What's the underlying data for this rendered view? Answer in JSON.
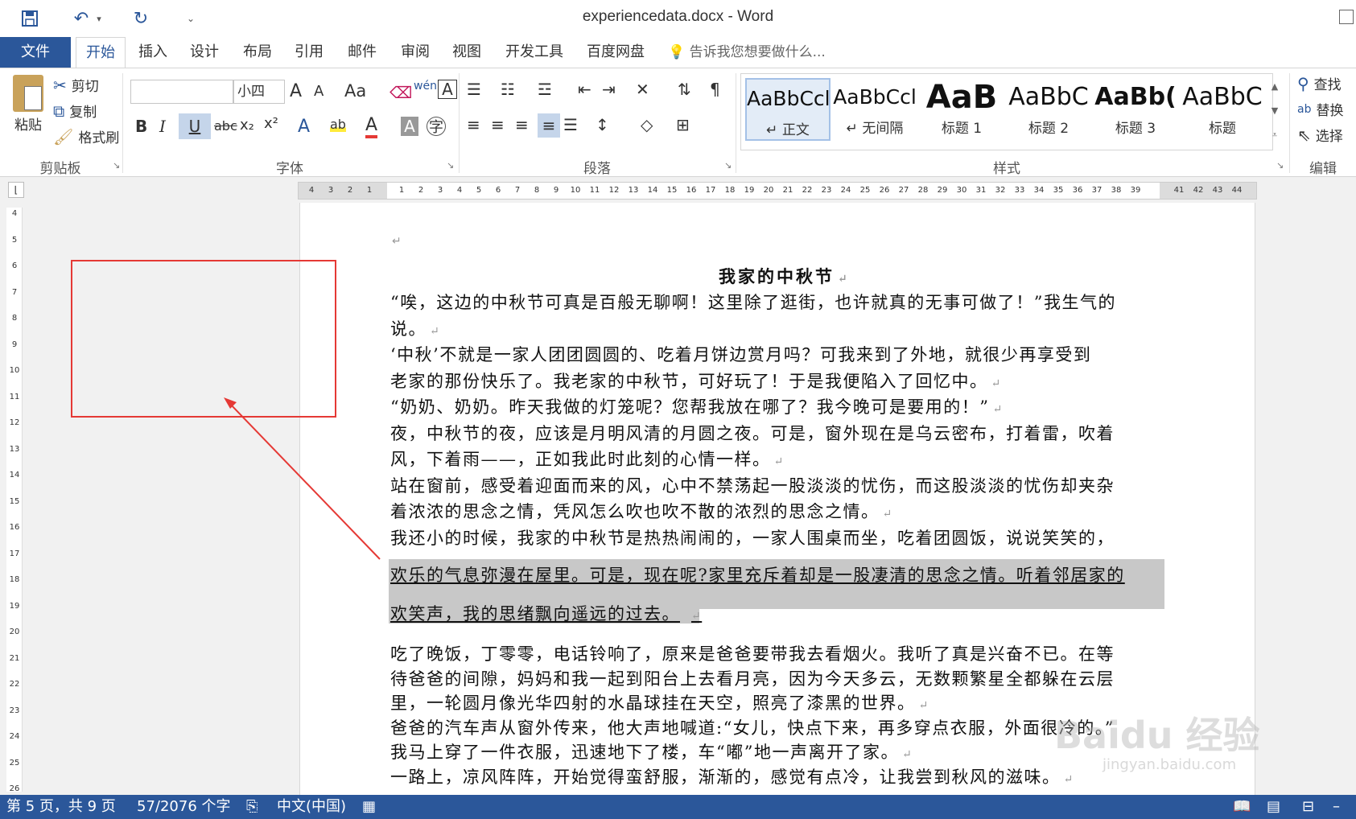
{
  "window": {
    "title": "experiencedata.docx - Word"
  },
  "ribbon_tabs": [
    "文件",
    "开始",
    "插入",
    "设计",
    "布局",
    "引用",
    "邮件",
    "审阅",
    "视图",
    "开发工具",
    "百度网盘"
  ],
  "tellme": "告诉我您想要做什么...",
  "clipboard": {
    "paste": "粘贴",
    "cut": "剪切",
    "copy": "复制",
    "format_painter": "格式刷",
    "label": "剪贴板"
  },
  "font": {
    "name": "",
    "size": "小四",
    "label": "字体",
    "bold": "B",
    "italic": "I",
    "underline": "U",
    "strike": "abc",
    "sub": "x₂",
    "sup": "x²",
    "change_case": "Aa",
    "grow": "A",
    "shrink": "A"
  },
  "paragraph": {
    "label": "段落"
  },
  "styles": {
    "label": "样式",
    "items": [
      {
        "sample": "AaBbCcl",
        "name": "↵ 正文"
      },
      {
        "sample": "AaBbCcl",
        "name": "↵ 无间隔"
      },
      {
        "sample": "AaB",
        "name": "标题 1"
      },
      {
        "sample": "AaBbC",
        "name": "标题 2"
      },
      {
        "sample": "AaBb(",
        "name": "标题 3"
      },
      {
        "sample": "AaBbC",
        "name": "标题"
      }
    ]
  },
  "editing": {
    "find": "查找",
    "replace": "替换",
    "select": "选择",
    "label": "编辑"
  },
  "ruler": {
    "left": [
      "4",
      "3",
      "2",
      "1"
    ],
    "right": [
      "1",
      "2",
      "3",
      "4",
      "5",
      "6",
      "7",
      "8",
      "9",
      "10",
      "11",
      "12",
      "13",
      "14",
      "15",
      "16",
      "17",
      "18",
      "19",
      "20",
      "21",
      "22",
      "23",
      "24",
      "25",
      "26",
      "27",
      "28",
      "29",
      "30",
      "31",
      "32",
      "33",
      "34",
      "35",
      "36",
      "37",
      "38",
      "39"
    ],
    "margin": [
      "41",
      "42",
      "43",
      "44"
    ]
  },
  "vruler": [
    "4",
    "5",
    "6",
    "7",
    "8",
    "9",
    "10",
    "11",
    "12",
    "13",
    "14",
    "15",
    "16",
    "17",
    "18",
    "19",
    "20",
    "21",
    "22",
    "23",
    "24",
    "25",
    "26"
  ],
  "document": {
    "title": "我家的中秋节",
    "lines": [
      "“唉，这边的中秋节可真是百般无聊啊！这里除了逛街，也许就真的无事可做了！”我生气的",
      "说。",
      "‘中秋’不就是一家人团团圆圆的、吃着月饼边赏月吗？可我来到了外地，就很少再享受到",
      "老家的那份快乐了。我老家的中秋节，可好玩了！于是我便陷入了回忆中。",
      "“奶奶、奶奶。昨天我做的灯笼呢？您帮我放在哪了？我今晚可是要用的！”",
      "夜，中秋节的夜，应该是月明风清的月圆之夜。可是，窗外现在是乌云密布，打着雷，吹着",
      "风，下着雨——，正如我此时此刻的心情一样。",
      "站在窗前，感受着迎面而来的风，心中不禁荡起一股淡淡的忧伤，而这股淡淡的忧伤却夹杂",
      "着浓浓的思念之情，凭风怎么吹也吹不散的浓烈的思念之情。",
      "我还小的时候，我家的中秋节是热热闹闹的，一家人围桌而坐，吃着团圆饭，说说笑笑的，"
    ],
    "hl_lines": [
      "欢乐的气息弥漫在屋里。可是，现在呢?家里充斥着却是一股凄清的思念之情。听着邻居家的",
      "欢笑声，我的思绪飘向遥远的过去。"
    ],
    "lines2": [
      "吃了晚饭，丁零零，电话铃响了，原来是爸爸要带我去看烟火。我听了真是兴奋不已。在等",
      "待爸爸的间隙，妈妈和我一起到阳台上去看月亮，因为今天多云，无数颗繁星全都躲在云层",
      "里，一轮圆月像光华四射的水晶球挂在天空，照亮了漆黑的世界。",
      "爸爸的汽车声从窗外传来，他大声地喊道:“女儿，快点下来，再多穿点衣服，外面很冷的。”",
      "我马上穿了一件衣服，迅速地下了楼，车“嘟”地一声离开了家。",
      "一路上，凉风阵阵，开始觉得蛮舒服，渐渐的，感觉有点冷，让我尝到秋风的滋味。"
    ]
  },
  "status": {
    "page": "第 5 页，共 9 页",
    "words": "57/2076 个字",
    "lang": "中文(中国)"
  },
  "watermark": {
    "text": "Baidu 经验",
    "url": "jingyan.baidu.com"
  },
  "colors": {
    "accent": "#2b579a",
    "annotation": "#e53935"
  }
}
